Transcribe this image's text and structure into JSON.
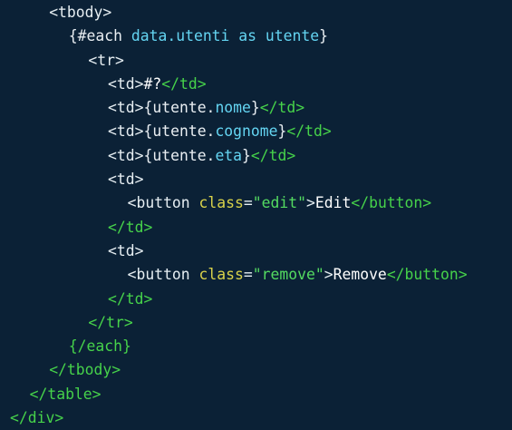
{
  "colors": {
    "background": "#0b2136",
    "tag": "#e6eef2",
    "close_tag": "#46d24a",
    "brace": "#e9eef2",
    "property": "#64d5f2",
    "attribute": "#d9d24a",
    "string": "#54db61",
    "text": "#ffffff"
  },
  "code": {
    "lines": [
      {
        "indent": 2,
        "segs": [
          {
            "t": "<tbody>",
            "k": "tag"
          }
        ]
      },
      {
        "indent": 3,
        "segs": [
          {
            "t": "{#each ",
            "k": "brace"
          },
          {
            "t": "data.utenti as utente",
            "k": "prop"
          },
          {
            "t": "}",
            "k": "brace"
          }
        ]
      },
      {
        "indent": 4,
        "segs": [
          {
            "t": "<tr>",
            "k": "tag"
          }
        ]
      },
      {
        "indent": 5,
        "segs": [
          {
            "t": "<td>",
            "k": "tag"
          },
          {
            "t": "#?",
            "k": "text"
          },
          {
            "t": "</td>",
            "k": "close"
          }
        ]
      },
      {
        "indent": 5,
        "segs": [
          {
            "t": "<td>",
            "k": "tag"
          },
          {
            "t": "{utente.",
            "k": "brace"
          },
          {
            "t": "nome",
            "k": "prop"
          },
          {
            "t": "}",
            "k": "brace"
          },
          {
            "t": "</td>",
            "k": "close"
          }
        ]
      },
      {
        "indent": 5,
        "segs": [
          {
            "t": "<td>",
            "k": "tag"
          },
          {
            "t": "{utente.",
            "k": "brace"
          },
          {
            "t": "cognome",
            "k": "prop"
          },
          {
            "t": "}",
            "k": "brace"
          },
          {
            "t": "</td>",
            "k": "close"
          }
        ]
      },
      {
        "indent": 5,
        "segs": [
          {
            "t": "<td>",
            "k": "tag"
          },
          {
            "t": "{utente.",
            "k": "brace"
          },
          {
            "t": "eta",
            "k": "prop"
          },
          {
            "t": "}",
            "k": "brace"
          },
          {
            "t": "</td>",
            "k": "close"
          }
        ]
      },
      {
        "indent": 5,
        "segs": [
          {
            "t": "<td>",
            "k": "tag"
          }
        ]
      },
      {
        "indent": 6,
        "segs": [
          {
            "t": "<button ",
            "k": "tag"
          },
          {
            "t": "class",
            "k": "attr"
          },
          {
            "t": "=",
            "k": "tag"
          },
          {
            "t": "\"edit\"",
            "k": "str"
          },
          {
            "t": ">",
            "k": "tag"
          },
          {
            "t": "Edit",
            "k": "text"
          },
          {
            "t": "</button>",
            "k": "close"
          }
        ]
      },
      {
        "indent": 5,
        "segs": [
          {
            "t": "</td>",
            "k": "close"
          }
        ]
      },
      {
        "indent": 5,
        "segs": [
          {
            "t": "<td>",
            "k": "tag"
          }
        ]
      },
      {
        "indent": 6,
        "segs": [
          {
            "t": "<button ",
            "k": "tag"
          },
          {
            "t": "class",
            "k": "attr"
          },
          {
            "t": "=",
            "k": "tag"
          },
          {
            "t": "\"remove\"",
            "k": "str"
          },
          {
            "t": ">",
            "k": "tag"
          },
          {
            "t": "Remove",
            "k": "text"
          },
          {
            "t": "</button>",
            "k": "close"
          }
        ]
      },
      {
        "indent": 5,
        "segs": [
          {
            "t": "</td>",
            "k": "close"
          }
        ]
      },
      {
        "indent": 4,
        "segs": [
          {
            "t": "</tr>",
            "k": "close"
          }
        ]
      },
      {
        "indent": 3,
        "segs": [
          {
            "t": "{/each}",
            "k": "close"
          }
        ]
      },
      {
        "indent": 2,
        "segs": [
          {
            "t": "</tbody>",
            "k": "close"
          }
        ]
      },
      {
        "indent": 1,
        "segs": [
          {
            "t": "</table>",
            "k": "close"
          }
        ]
      },
      {
        "indent": 0,
        "segs": [
          {
            "t": "</div>",
            "k": "close"
          }
        ]
      }
    ]
  }
}
